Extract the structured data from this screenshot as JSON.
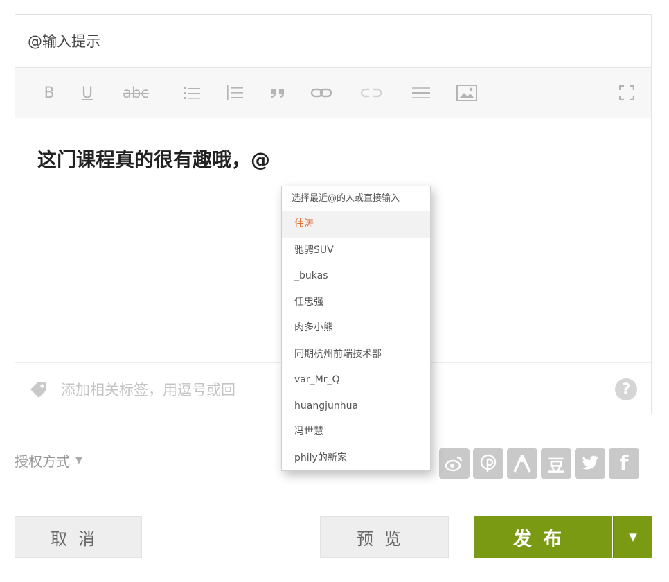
{
  "editor": {
    "title_value": "@输入提示",
    "content_text": "这门课程真的很有趣哦，@",
    "tags_placeholder": "添加相关标签，用逗号或回",
    "help_symbol": "?"
  },
  "toolbar": {
    "bold": "B",
    "underline": "U",
    "strikethrough": "abc"
  },
  "mention_popup": {
    "hint": "选择最近@的人或直接输入",
    "items": [
      {
        "label": "伟涛"
      },
      {
        "label": "驰骋SUV"
      },
      {
        "label": "_bukas"
      },
      {
        "label": "任忠强"
      },
      {
        "label": "肉多小熊"
      },
      {
        "label": "同期杭州前端技术部"
      },
      {
        "label": "var_Mr_Q"
      },
      {
        "label": "huangjunhua"
      },
      {
        "label": "冯世慧"
      },
      {
        "label": "phily的新家"
      }
    ],
    "active_index": 0,
    "active_color": "#e26a2c"
  },
  "license": {
    "label": "授权方式"
  },
  "share": {
    "icons": [
      "weibo-icon",
      "pinterest-icon",
      "renren-icon",
      "douban-icon",
      "twitter-icon",
      "facebook-icon"
    ],
    "douban_glyph": "豆",
    "facebook_glyph": "f"
  },
  "buttons": {
    "cancel": "取消",
    "preview": "预览",
    "publish": "发布"
  },
  "colors": {
    "publish_bg": "#7a9a13"
  }
}
